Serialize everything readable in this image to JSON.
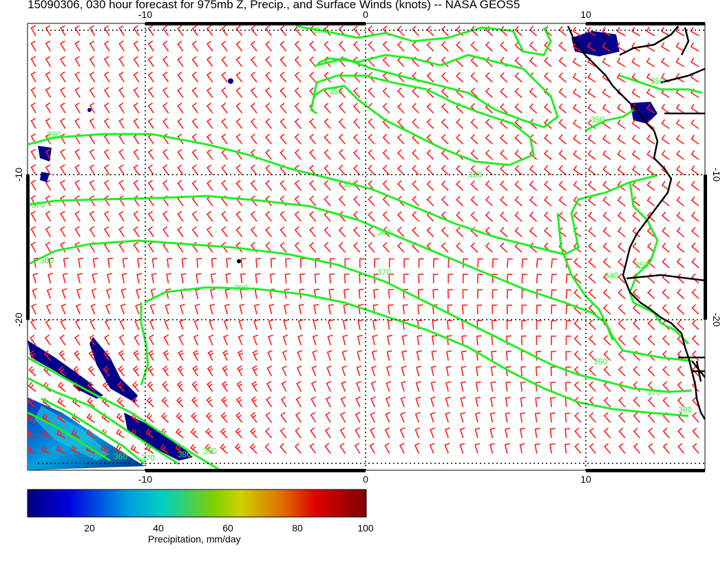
{
  "title": "15090306, 030 hour forecast for 975mb Z, Precip., and Surface Winds (knots) -- NASA GEOS5",
  "map": {
    "lon_ticks": [
      "-10",
      "0",
      "10"
    ],
    "lat_ticks": [
      "-10",
      "-20"
    ],
    "contour_labels": [
      "350",
      "350",
      "350",
      "350",
      "360",
      "370",
      "370",
      "380",
      "380",
      "390",
      "380",
      "370",
      "360",
      "340",
      "350",
      "350",
      "350",
      "360",
      "370",
      "380",
      "390"
    ],
    "colors": {
      "contour": "#22ee22",
      "wind": "#ff1a1a",
      "coast": "#000000",
      "precip_low": "#00008b",
      "precip_high": "#8b0000"
    }
  },
  "colorbar": {
    "title": "Precipitation, mm/day",
    "ticks": [
      "20",
      "40",
      "60",
      "80",
      "100"
    ]
  }
}
